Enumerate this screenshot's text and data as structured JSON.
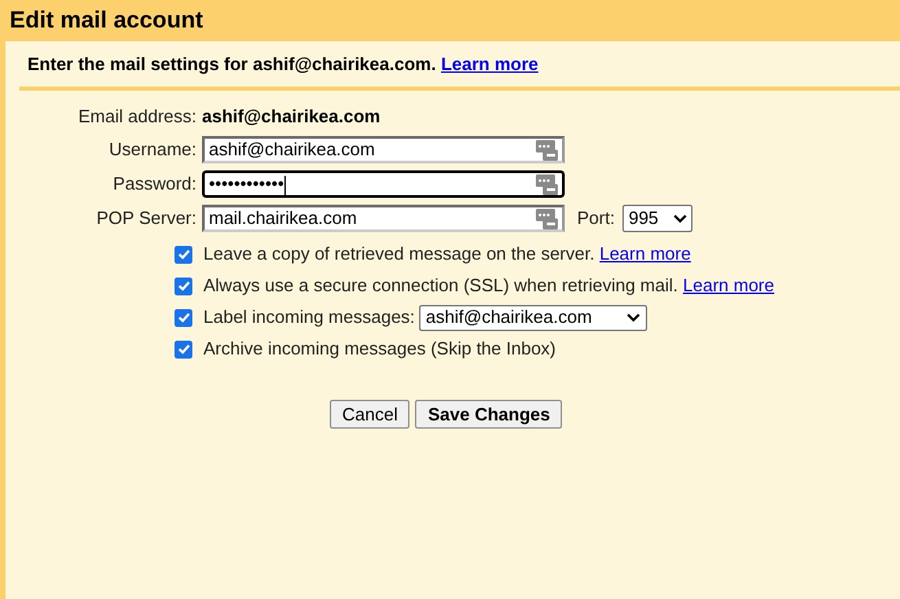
{
  "title": "Edit mail account",
  "intro": {
    "text": "Enter the mail settings for ashif@chairikea.com.",
    "link": "Learn more"
  },
  "email": {
    "label": "Email address:",
    "value": "ashif@chairikea.com"
  },
  "fields": [
    {
      "label": "Username:",
      "value": "ashif@chairikea.com",
      "focused": false
    },
    {
      "label": "Password:",
      "value": "••••••••••••",
      "focused": true
    },
    {
      "label": "POP Server:",
      "value": "mail.chairikea.com",
      "focused": false
    }
  ],
  "port": {
    "label": "Port:",
    "value": "995"
  },
  "options": [
    {
      "kind": "plain",
      "label": "Leave a copy of retrieved message on the server.",
      "link": "Learn more",
      "checked": true
    },
    {
      "kind": "plain",
      "label": "Always use a secure connection (SSL) when retrieving mail.",
      "link": "Learn more",
      "checked": true
    },
    {
      "kind": "select",
      "label": "Label incoming messages:",
      "value": "ashif@chairikea.com",
      "checked": true
    },
    {
      "kind": "plain",
      "label": "Archive incoming messages (Skip the Inbox)",
      "checked": true
    }
  ],
  "buttons": [
    {
      "label": "Cancel",
      "primary": false
    },
    {
      "label": "Save Changes",
      "primary": true
    }
  ]
}
